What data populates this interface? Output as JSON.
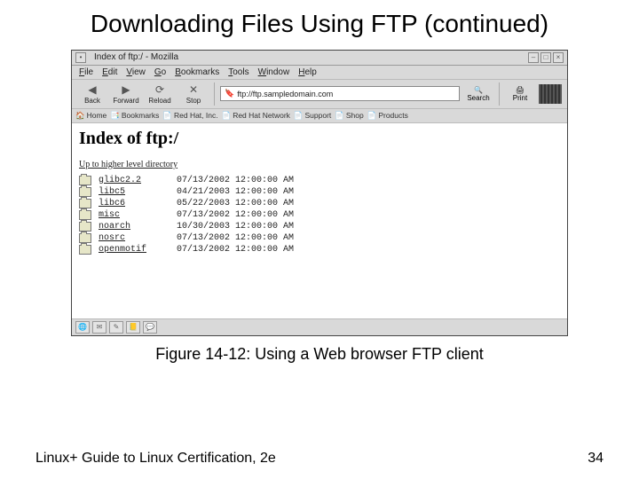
{
  "slide": {
    "title": "Downloading Files Using FTP (continued)",
    "caption": "Figure 14-12: Using a Web browser FTP client",
    "footer_left": "Linux+ Guide to Linux Certification, 2e",
    "footer_right": "34"
  },
  "browser": {
    "window_title": "Index of ftp:/ - Mozilla",
    "menus": [
      "File",
      "Edit",
      "View",
      "Go",
      "Bookmarks",
      "Tools",
      "Window",
      "Help"
    ],
    "toolbar": {
      "back": "Back",
      "forward": "Forward",
      "reload": "Reload",
      "stop": "Stop",
      "search": "Search",
      "print": "Print"
    },
    "url_prefix": "🔖",
    "url": "ftp://ftp.sampledomain.com",
    "personal_bar": [
      "Home",
      "Bookmarks",
      "Red Hat, Inc.",
      "Red Hat Network",
      "Support",
      "Shop",
      "Products"
    ],
    "page_heading": "Index of ftp:/",
    "up_link": "Up to higher level directory",
    "listing": [
      {
        "name": "glibc2.2",
        "date": "07/13/2002 12:00:00 AM"
      },
      {
        "name": "libc5",
        "date": "04/21/2003 12:00:00 AM"
      },
      {
        "name": "libc6",
        "date": "05/22/2003 12:00:00 AM"
      },
      {
        "name": "misc",
        "date": "07/13/2002 12:00:00 AM"
      },
      {
        "name": "noarch",
        "date": "10/30/2003 12:00:00 AM"
      },
      {
        "name": "nosrc",
        "date": "07/13/2002 12:00:00 AM"
      },
      {
        "name": "openmotif",
        "date": "07/13/2002 12:00:00 AM"
      }
    ]
  }
}
